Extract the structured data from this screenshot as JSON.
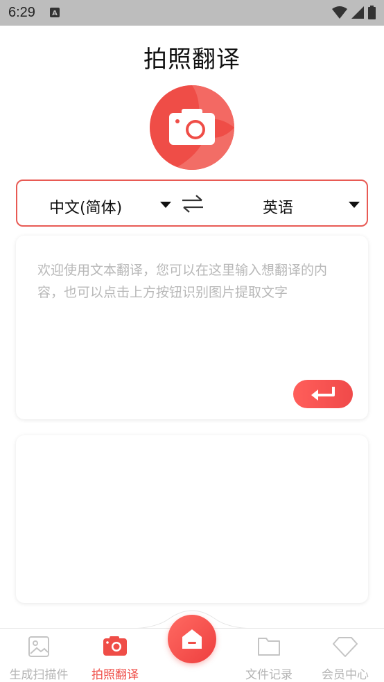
{
  "status_bar": {
    "time": "6:29"
  },
  "page": {
    "title": "拍照翻译"
  },
  "languages": {
    "source": "中文(简体)",
    "target": "英语"
  },
  "input": {
    "placeholder": "欢迎使用文本翻译，您可以在这里输入想翻译的内容，也可以点击上方按钮识别图片提取文字",
    "value": ""
  },
  "output": {
    "text": ""
  },
  "bottom_nav": {
    "items": [
      {
        "label": "生成扫描件",
        "icon": "image-icon",
        "active": false
      },
      {
        "label": "拍照翻译",
        "icon": "camera-icon",
        "active": true
      },
      {
        "label": "",
        "icon": "home-icon",
        "active": false
      },
      {
        "label": "文件记录",
        "icon": "folder-icon",
        "active": false
      },
      {
        "label": "会员中心",
        "icon": "diamond-icon",
        "active": false
      }
    ]
  },
  "colors": {
    "accent": "#ef4d47",
    "inactive": "#b5b5b5",
    "status_bar": "#bdbdbd"
  }
}
